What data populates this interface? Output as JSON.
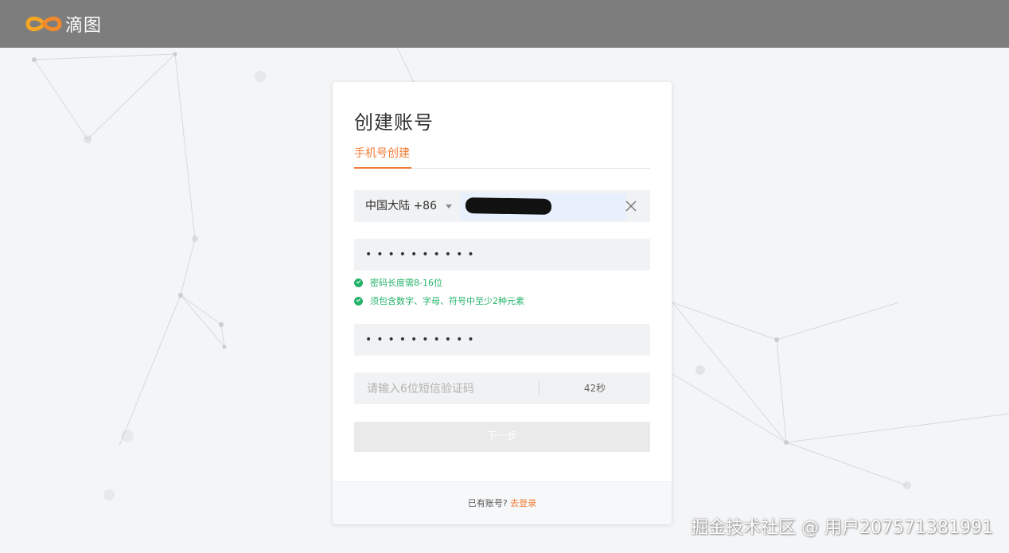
{
  "header": {
    "brand_name": "滴图",
    "logo_icon": "infinity-logo-icon",
    "brand_colors": {
      "orange": "#f5a623",
      "red": "#e8553a"
    }
  },
  "card": {
    "title": "创建账号",
    "tabs": [
      {
        "label": "手机号创建",
        "active": true
      }
    ],
    "phone": {
      "country_label": "中国大陆 +86",
      "value": "",
      "clear_icon": "close-icon"
    },
    "password": {
      "masked_value": "••••••••••",
      "rules": [
        {
          "text": "密码长度需8-16位",
          "satisfied": true
        },
        {
          "text": "须包含数字、字母、符号中至少2种元素",
          "satisfied": true
        }
      ]
    },
    "confirm_password": {
      "masked_value": "••••••••••"
    },
    "sms_code": {
      "placeholder": "请输入6位短信验证码",
      "countdown": "42秒"
    },
    "next_button": "下一步",
    "footer": {
      "prompt": "已有账号?",
      "login_link": "去登录"
    }
  },
  "watermark": "掘金技术社区 @ 用户207571381991",
  "colors": {
    "accent": "#f07c35",
    "success": "#25b36a",
    "header_bg": "#7d7d7e"
  }
}
